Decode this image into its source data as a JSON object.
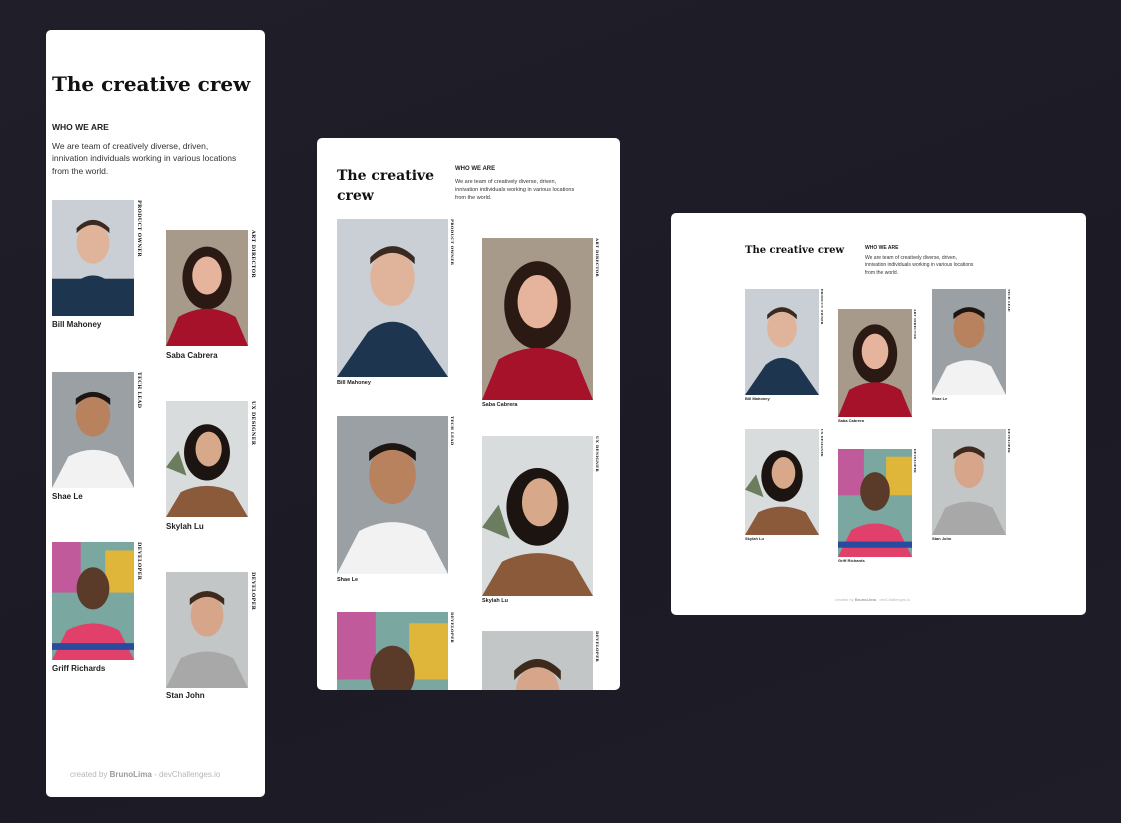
{
  "title": "The creative crew",
  "title_line1": "The creative",
  "title_line2": "crew",
  "section_heading": "WHO WE ARE",
  "description": "We are team of creatively diverse, driven, innivation individuals working in various locations from the world.",
  "members": [
    {
      "name": "Bill Mahoney",
      "role": "Product Owner"
    },
    {
      "name": "Saba Cabrera",
      "role": "Art Director"
    },
    {
      "name": "Shae Le",
      "role": "Tech Lead"
    },
    {
      "name": "Skylah Lu",
      "role": "UX Designer"
    },
    {
      "name": "Griff Richards",
      "role": "Developer"
    },
    {
      "name": "Stan John",
      "role": "Developer"
    }
  ],
  "credit": {
    "prefix": "created by",
    "author": "BrunoLima",
    "suffix": "- devChallenges.io"
  },
  "colors": {
    "background": "#1f1d27",
    "card": "#ffffff",
    "text": "#111111",
    "credit": "#b7b7b7"
  }
}
